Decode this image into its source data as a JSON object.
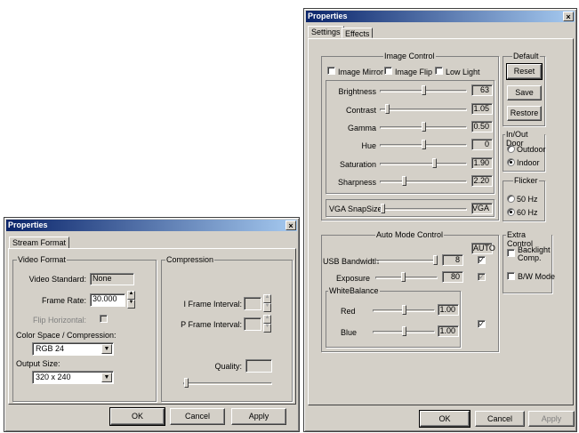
{
  "left_window": {
    "title": "Properties",
    "tab": "Stream Format",
    "video_format": {
      "group_label": "Video Format",
      "video_standard_label": "Video Standard:",
      "video_standard_value": "None",
      "frame_rate_label": "Frame Rate:",
      "frame_rate_value": "30.000",
      "flip_horizontal_label": "Flip Horizontal:",
      "color_space_label": "Color Space / Compression:",
      "color_space_value": "RGB 24",
      "output_size_label": "Output Size:",
      "output_size_value": "320 x 240"
    },
    "compression": {
      "group_label": "Compression",
      "i_frame_label": "I Frame Interval:",
      "p_frame_label": "P Frame Interval:",
      "quality_label": "Quality:"
    },
    "buttons": {
      "ok": "OK",
      "cancel": "Cancel",
      "apply": "Apply"
    }
  },
  "right_window": {
    "title": "Properties",
    "tabs": [
      "Settings",
      "Effects"
    ],
    "image_control": {
      "group_label": "Image Control",
      "image_mirror": "Image Mirror",
      "image_flip": "Image Flip",
      "low_light": "Low Light",
      "sliders": [
        {
          "label": "Brightness",
          "value": "63",
          "level": 0.5
        },
        {
          "label": "Contrast",
          "value": "1.05",
          "level": 0.06
        },
        {
          "label": "Gamma",
          "value": "0.50",
          "level": 0.5
        },
        {
          "label": "Hue",
          "value": "0",
          "level": 0.5
        },
        {
          "label": "Saturation",
          "value": "1.90",
          "level": 0.63
        },
        {
          "label": "Sharpness",
          "value": "2.20",
          "level": 0.27
        }
      ],
      "vga_snapsize_label": "VGA SnapSize",
      "vga_snapsize_value": "VGA"
    },
    "default": {
      "group_label": "Default",
      "reset": "Reset",
      "save": "Save",
      "restore": "Restore"
    },
    "in_out_door": {
      "group_label": "In/Out Door",
      "outdoor": "Outdoor",
      "indoor": "Indoor"
    },
    "flicker": {
      "group_label": "Flicker",
      "hz50": "50 Hz",
      "hz60": "60 Hz"
    },
    "auto_mode": {
      "group_label": "Auto Mode Control",
      "auto_header": "AUTO",
      "usb_bandwidth_label": "USB Bandwidth",
      "usb_bandwidth_value": "8",
      "usb_bandwidth_level": 1.0,
      "exposure_label": "Exposure",
      "exposure_value": "80",
      "exposure_level": 0.45,
      "white_balance_label": "WhiteBalance",
      "red_label": "Red",
      "red_value": "1.00",
      "red_level": 0.5,
      "blue_label": "Blue",
      "blue_value": "1.00",
      "blue_level": 0.5
    },
    "extra_control": {
      "group_label": "Extra Control",
      "backlight_comp": "Backlight Comp.",
      "bw_mode": "B/W Mode"
    },
    "buttons": {
      "ok": "OK",
      "cancel": "Cancel",
      "apply": "Apply"
    }
  }
}
